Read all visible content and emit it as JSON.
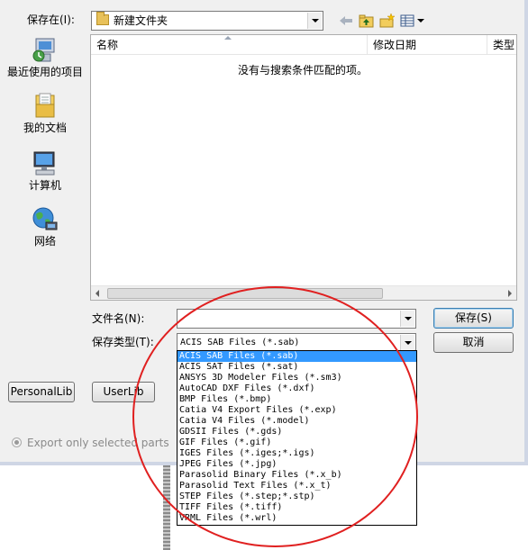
{
  "save_in": {
    "label": "保存在(I):",
    "value": "新建文件夹"
  },
  "toolbar": {
    "back_icon": "back-arrow-icon",
    "up_icon": "up-folder-icon",
    "new_folder_icon": "new-folder-icon",
    "view_menu_icon": "view-menu-icon"
  },
  "places": [
    {
      "label": "最近使用的项目",
      "icon": "recent-items-icon"
    },
    {
      "label": "我的文档",
      "icon": "documents-icon"
    },
    {
      "label": "计算机",
      "icon": "computer-icon"
    },
    {
      "label": "网络",
      "icon": "network-icon"
    }
  ],
  "file_list": {
    "columns": [
      "名称",
      "修改日期",
      "类型"
    ],
    "empty_message": "没有与搜索条件匹配的项。"
  },
  "file_name": {
    "label": "文件名(N):",
    "value": ""
  },
  "file_type": {
    "label": "保存类型(T):",
    "value": "ACIS SAB Files (*.sab)",
    "options": [
      "ACIS SAB Files (*.sab)",
      "ACIS SAT Files (*.sat)",
      "ANSYS 3D Modeler Files (*.sm3)",
      "AutoCAD DXF Files (*.dxf)",
      "BMP Files (*.bmp)",
      "Catia V4 Export Files (*.exp)",
      "Catia V4 Files (*.model)",
      "GDSII Files (*.gds)",
      "GIF Files (*.gif)",
      "IGES Files (*.iges;*.igs)",
      "JPEG Files (*.jpg)",
      "Parasolid Binary Files (*.x_b)",
      "Parasolid Text Files (*.x_t)",
      "STEP Files (*.step;*.stp)",
      "TIFF Files (*.tiff)",
      "VRML Files (*.wrl)"
    ]
  },
  "buttons": {
    "save": "保存(S)",
    "cancel": "取消",
    "personal_lib": "PersonalLib",
    "user_lib": "UserLib"
  },
  "export_only_selected": "Export only selected parts",
  "colors": {
    "selection": "#3399ff",
    "annotation_circle": "#e02020",
    "dialog_bg": "#f0f0f0"
  }
}
